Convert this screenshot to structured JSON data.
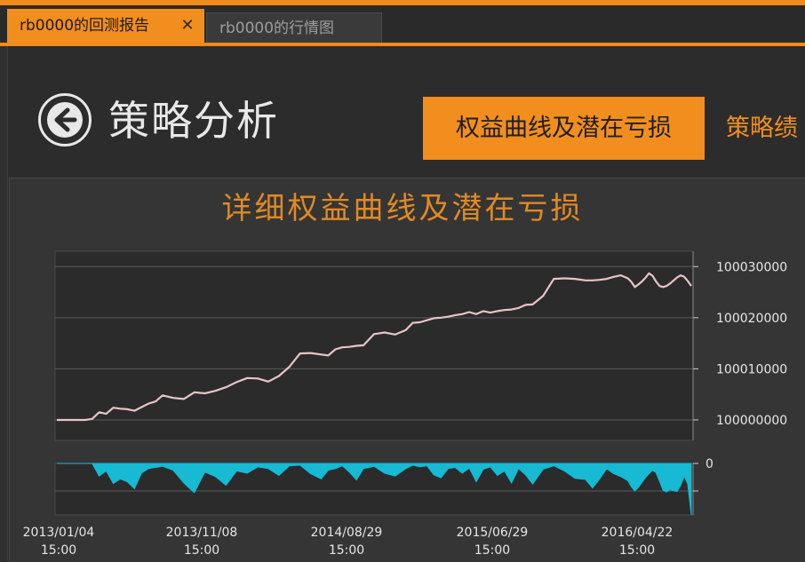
{
  "tabs": {
    "active_label": "rb0000的回测报告",
    "close_glyph": "✕",
    "inactive_label": "rb0000的行情图"
  },
  "header": {
    "title": "策略分析",
    "nav_active": "权益曲线及潜在亏损",
    "nav_next": "策略绩"
  },
  "colors": {
    "accent": "#f28e1d",
    "equity_line": "#e8c4c8",
    "drawdown_fill": "#17b9d3"
  },
  "chart_data": {
    "type": "area",
    "title": "详细权益曲线及潜在亏损",
    "equity": {
      "type": "line",
      "y_ticks": [
        100000000,
        100010000,
        100020000,
        100030000
      ],
      "ylim": [
        99996000,
        100033000
      ],
      "x": [
        0,
        4,
        8,
        10,
        12,
        14,
        16,
        18,
        20,
        22,
        24,
        26,
        28,
        30,
        33,
        36,
        39,
        42,
        45,
        48,
        51,
        54,
        57,
        60,
        63,
        66,
        69,
        72,
        75,
        77,
        79,
        81,
        83,
        85,
        87,
        90,
        93,
        96,
        99,
        101,
        103,
        105,
        107,
        109,
        111,
        113,
        115,
        117,
        119,
        121,
        123,
        125,
        127,
        129,
        131,
        133,
        135,
        138,
        141,
        144,
        147,
        150,
        152,
        154,
        156,
        158,
        160,
        162,
        163,
        164,
        165,
        166,
        167,
        168,
        169,
        170,
        171,
        172,
        173,
        174,
        175,
        176,
        177,
        178,
        179,
        180
      ],
      "y": [
        100000000,
        100000000,
        100000000,
        100000200,
        100001500,
        100001200,
        100002400,
        100002200,
        100002100,
        100001800,
        100002500,
        100003200,
        100003600,
        100004800,
        100004300,
        100004100,
        100005400,
        100005200,
        100005700,
        100006400,
        100007400,
        100008200,
        100008100,
        100007500,
        100008600,
        100010400,
        100013000,
        100013100,
        100012800,
        100012600,
        100013800,
        100014200,
        100014300,
        100014500,
        100014600,
        100016800,
        100017100,
        100016700,
        100017600,
        100019000,
        100019100,
        100019500,
        100019900,
        100020000,
        100020200,
        100020500,
        100020700,
        100021100,
        100020700,
        100021300,
        100021000,
        100021300,
        100021500,
        100021600,
        100021900,
        100022500,
        100022600,
        100024300,
        100027600,
        100027700,
        100027600,
        100027300,
        100027300,
        100027400,
        100027600,
        100028000,
        100028300,
        100027700,
        100027000,
        100026000,
        100026500,
        100027100,
        100027800,
        100028700,
        100028200,
        100027100,
        100026200,
        100026000,
        100026200,
        100026700,
        100027300,
        100027900,
        100028300,
        100028000,
        100027200,
        100026200
      ]
    },
    "drawdown": {
      "type": "area",
      "y_ticks": [
        0
      ],
      "x": [
        0,
        4,
        8,
        10,
        12,
        14,
        16,
        18,
        20,
        22,
        24,
        26,
        28,
        30,
        33,
        36,
        39,
        42,
        45,
        48,
        51,
        54,
        57,
        60,
        63,
        66,
        69,
        72,
        75,
        77,
        79,
        81,
        83,
        85,
        87,
        90,
        93,
        96,
        99,
        101,
        103,
        105,
        107,
        109,
        111,
        113,
        115,
        117,
        119,
        121,
        123,
        125,
        127,
        129,
        131,
        133,
        135,
        138,
        141,
        144,
        147,
        150,
        152,
        154,
        156,
        158,
        160,
        162,
        163,
        164,
        165,
        166,
        167,
        168,
        169,
        170,
        171,
        172,
        173,
        174,
        175,
        176,
        177,
        178,
        179,
        180
      ],
      "y": [
        0,
        0,
        0,
        0,
        -2200,
        -1300,
        -3500,
        -2700,
        -3200,
        -4400,
        -1700,
        -900,
        -700,
        -500,
        -1200,
        -3400,
        -5100,
        -1500,
        -2300,
        -3800,
        -1300,
        -1700,
        -600,
        -900,
        -2100,
        -400,
        -300,
        -1800,
        -2700,
        -1200,
        -900,
        -400,
        -1500,
        -2900,
        -900,
        -500,
        -1700,
        -2200,
        -900,
        -300,
        -600,
        -400,
        -2000,
        -2500,
        -900,
        -700,
        -1700,
        -800,
        -3200,
        -1000,
        -600,
        -2100,
        -1300,
        -3400,
        -900,
        -2000,
        -3600,
        -1000,
        -400,
        -1300,
        -2600,
        -2800,
        -4300,
        -2700,
        -900,
        -1800,
        -2300,
        -3000,
        -4100,
        -4800,
        -4200,
        -3300,
        -2500,
        -1800,
        -1200,
        -1600,
        -3100,
        -4700,
        -5000,
        -4600,
        -4800,
        -4900,
        -3800,
        -2200,
        -3600,
        -9000
      ]
    },
    "x_labels": [
      {
        "date": "2013/01/04",
        "time": "15:00"
      },
      {
        "date": "2013/11/08",
        "time": "15:00"
      },
      {
        "date": "2014/08/29",
        "time": "15:00"
      },
      {
        "date": "2015/06/29",
        "time": "15:00"
      },
      {
        "date": "2016/04/22",
        "time": "15:00"
      }
    ],
    "grid": true
  }
}
